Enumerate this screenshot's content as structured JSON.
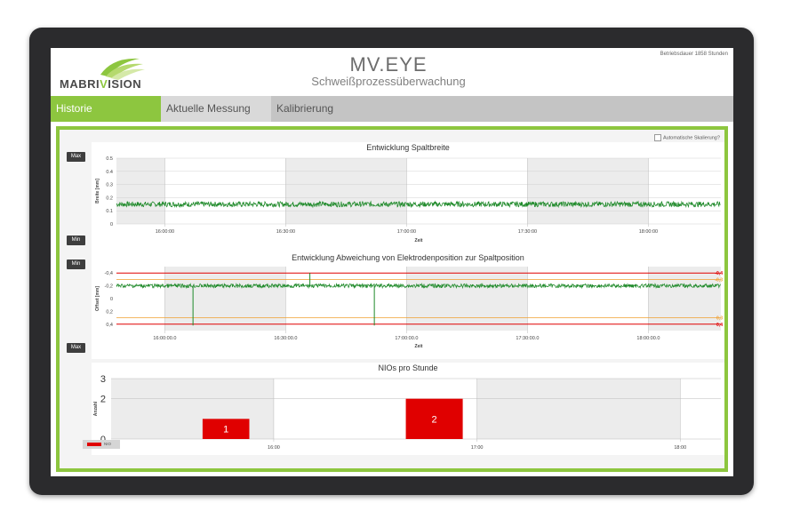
{
  "header": {
    "logo_text_left": "MABRI",
    "logo_text_v": "V",
    "logo_text_right": "ISION",
    "app_title": "MV.EYE",
    "app_subtitle": "Schweißprozessüberwachung",
    "operating_hours": "Betriebsdauer 1858 Stunden"
  },
  "tabs": [
    {
      "label": "Historie",
      "active": true
    },
    {
      "label": "Aktuelle Messung",
      "active": false
    },
    {
      "label": "Kalibrierung",
      "active": false
    }
  ],
  "controls": {
    "auto_scale_label": "Automatische Skalierung?",
    "max_label": "Max",
    "min_label": "Min"
  },
  "colors": {
    "accent": "#8dc63f",
    "series": "#1f8a2a",
    "limit": "#e00000",
    "warning": "#f0a030"
  },
  "chart_data": [
    {
      "type": "line",
      "title": "Entwicklung Spaltbreite",
      "xlabel": "Zeit",
      "ylabel": "Breite [mm]",
      "ylim": [
        0,
        0.5
      ],
      "yticks": [
        "0.5",
        "0.4",
        "0.3",
        "0.2",
        "0.1",
        "0"
      ],
      "xticks": [
        "16:00:00",
        "16:30:00",
        "17:00:00",
        "17:30:00",
        "18:00:00"
      ],
      "series": [
        {
          "mean": 0.15,
          "noise": 0.02
        }
      ]
    },
    {
      "type": "line",
      "title": "Entwicklung Abweichung von Elektrodenposition zur Spaltposition",
      "xlabel": "Zeit",
      "ylabel": "Offset [mm]",
      "ylim": [
        -0.5,
        0.5
      ],
      "yticks": [
        "-0,4",
        "-0,2",
        "0",
        "0,2",
        "0,4"
      ],
      "xticks": [
        "16:00:00.0",
        "16:30:00.0",
        "17:00:00.0",
        "17:30:00.0",
        "18:00:00.0"
      ],
      "limits": {
        "red": [
          -0.4,
          0.4
        ],
        "orange": [
          -0.3,
          0.3
        ]
      },
      "limit_labels_right": [
        "-0,4",
        "-0,3",
        "0,3",
        "0,4"
      ],
      "series": [
        {
          "mean": -0.2,
          "noise": 0.03
        }
      ],
      "spikes": [
        {
          "time": "16:07",
          "value": 0.42
        },
        {
          "time": "16:36",
          "value": -0.4
        },
        {
          "time": "16:52",
          "value": 0.42
        }
      ]
    },
    {
      "type": "bar",
      "title": "NIOs pro Stunde",
      "ylabel": "Anzahl",
      "ylim": [
        0,
        3
      ],
      "yticks": [
        "3",
        "2",
        "0"
      ],
      "xticks": [
        "16:00",
        "17:00",
        "18:00"
      ],
      "series": [
        {
          "name": "NIO",
          "values": [
            1,
            2
          ]
        }
      ],
      "bar_labels": [
        "1",
        "2"
      ]
    }
  ]
}
